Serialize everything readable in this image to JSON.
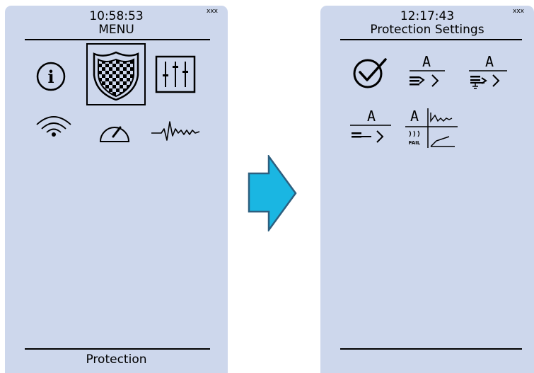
{
  "left_screen": {
    "time": "10:58:53",
    "badge": "xxx",
    "title": "MENU",
    "footer": "Protection",
    "icons": [
      "info-icon",
      "protection-shield-icon",
      "settings-sliders-icon",
      "wireless-icon",
      "gauge-icon",
      "waveform-icon"
    ],
    "selected": "protection-shield-icon"
  },
  "right_screen": {
    "time": "12:17:43",
    "badge": "xxx",
    "title": "Protection Settings",
    "icons": {
      "check": "check-circle-icon",
      "ground_fault_label": "A",
      "earth_fault_label": "A",
      "overcurrent_label": "A",
      "fault_log_label": "A",
      "fault_text": "FAIL"
    }
  },
  "colors": {
    "screen_bg": "#cdd7ec",
    "arrow_fill": "#1ab6e2",
    "arrow_stroke": "#2d5f7f"
  }
}
